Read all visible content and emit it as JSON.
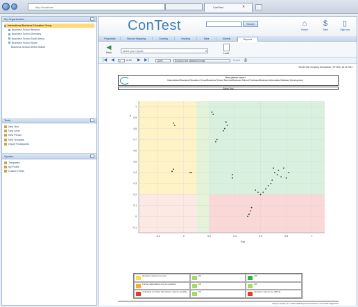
{
  "browser": {
    "address": "http://localhost",
    "tab_title": "ConTest"
  },
  "sidebar": {
    "org_title": "My Organization",
    "tree": [
      "International Business Education Group",
      "Business School Benelux",
      "Business School Germany",
      "Business School South Africa",
      "Business School Spain",
      "Business School United States"
    ],
    "tools_title": "Tests",
    "tools": [
      "New Test",
      "New Level",
      "New Period",
      "New Template",
      "Import Participants"
    ],
    "system_title": "System",
    "system": [
      "Templates",
      "My Profile",
      "Custom Fields"
    ]
  },
  "header": {
    "app_title": "ConTest",
    "search_placeholder": "",
    "search_button": "Search",
    "home_label": "Home",
    "jobs_label": "Jobs",
    "signout_label": "Sign out",
    "home_icon": "house-icon",
    "jobs_icon": "dollar-icon",
    "signout_icon": "door-icon"
  },
  "tabs": [
    "Properties",
    "Second Mapping",
    "Scoring",
    "Grading",
    "Data",
    "Models",
    "Reports"
  ],
  "active_tab": "Reports",
  "toolbar": {
    "back_label": "Back",
    "report_select_value": "select your reports",
    "load_label": "Load"
  },
  "viewer": {
    "page_value": "1",
    "page_of": "of 13",
    "zoom_value": "100%",
    "export_label": "Export to the selected format",
    "export_link": "Export",
    "timestamp": "Telerik Vide Scripting Introduction (TST301) 16.11.2011"
  },
  "report": {
    "title": "New please report",
    "subtitle": "International Business Education Group/Business School Benelux/Business School Professor/Business Information/Software Development",
    "strip": "Entire Test",
    "footer": "Report version: 2.1.1116.1461 Report Generated: 16.11.2011 Page:6/13"
  },
  "chart_data": {
    "type": "scatter",
    "xlabel": "Rar",
    "ylabel": "p",
    "xticks": [
      "-0.2",
      "0",
      "0.2",
      "0.4",
      "0.6",
      "0.8",
      "1"
    ],
    "yticks": [
      "-0.1",
      "0",
      "0.1",
      "0.2",
      "0.3",
      "0.4",
      "0.5",
      "0.6",
      "0.7",
      "0.8",
      "0.9",
      "1"
    ],
    "xlim": [
      -0.35,
      1.1
    ],
    "ylim": [
      -0.15,
      1.05
    ],
    "zones": [
      {
        "x": [
          -0.35,
          0.1
        ],
        "y": [
          0.2,
          1.05
        ],
        "color": "#fdf3c6"
      },
      {
        "x": [
          0.1,
          0.2
        ],
        "y": [
          0.2,
          1.05
        ],
        "color": "#e2f3d8"
      },
      {
        "x": [
          0.2,
          1.1
        ],
        "y": [
          0.2,
          1.05
        ],
        "color": "#d9f0df"
      },
      {
        "x": [
          -0.35,
          0.1
        ],
        "y": [
          -0.15,
          0.2
        ],
        "color": "#fde9e4"
      },
      {
        "x": [
          0.1,
          0.2
        ],
        "y": [
          -0.15,
          0.2
        ],
        "color": "#e6f2da"
      },
      {
        "x": [
          0.2,
          1.1
        ],
        "y": [
          -0.15,
          0.2
        ],
        "color": "#fbd8d8"
      }
    ],
    "points": [
      {
        "x": -0.08,
        "y": 0.85
      },
      {
        "x": -0.07,
        "y": 0.83
      },
      {
        "x": -0.09,
        "y": 0.41
      },
      {
        "x": -0.08,
        "y": 0.43
      },
      {
        "x": 0.05,
        "y": 0.4
      },
      {
        "x": 0.06,
        "y": 0.4
      },
      {
        "x": 0.22,
        "y": 0.95
      },
      {
        "x": 0.23,
        "y": 0.93
      },
      {
        "x": 0.33,
        "y": 0.86
      },
      {
        "x": 0.34,
        "y": 0.83
      },
      {
        "x": 0.32,
        "y": 0.8
      },
      {
        "x": 0.31,
        "y": 0.78
      },
      {
        "x": 0.26,
        "y": 0.7
      },
      {
        "x": 0.25,
        "y": 0.68
      },
      {
        "x": 0.38,
        "y": 0.38
      },
      {
        "x": 0.38,
        "y": 0.35
      },
      {
        "x": 0.7,
        "y": 0.44
      },
      {
        "x": 0.71,
        "y": 0.4
      },
      {
        "x": 0.74,
        "y": 0.42
      },
      {
        "x": 0.73,
        "y": 0.38
      },
      {
        "x": 0.76,
        "y": 0.36
      },
      {
        "x": 0.69,
        "y": 0.33
      },
      {
        "x": 0.68,
        "y": 0.3
      },
      {
        "x": 0.66,
        "y": 0.28
      },
      {
        "x": 0.64,
        "y": 0.25
      },
      {
        "x": 0.62,
        "y": 0.22
      },
      {
        "x": 0.6,
        "y": 0.2
      },
      {
        "x": 0.58,
        "y": 0.22
      },
      {
        "x": 0.56,
        "y": 0.24
      },
      {
        "x": 0.8,
        "y": 0.35
      },
      {
        "x": 0.82,
        "y": 0.4
      },
      {
        "x": 0.78,
        "y": 0.44
      },
      {
        "x": 0.52,
        "y": 0.05
      },
      {
        "x": 0.51,
        "y": 0.02
      },
      {
        "x": 0.5,
        "y": 0.0
      },
      {
        "x": 0.53,
        "y": 0.08
      }
    ]
  },
  "legend": [
    {
      "text": "Question may be too easy",
      "color": "#f5e04a"
    },
    {
      "text": "OK",
      "color": "#a6d86b"
    },
    {
      "text": "OK",
      "color": "#2fb24a"
    },
    {
      "text": "Further alternatives may be possible",
      "color": "#f0b030"
    },
    {
      "text": "OK",
      "color": "#a6d86b"
    },
    {
      "text": "OK",
      "color": "#a6d86b"
    },
    {
      "text": "Ambiguity or further alternatives may be possible",
      "color": "#e33a2a"
    },
    {
      "text": "OK",
      "color": "#a6d86b"
    },
    {
      "text": "Question may be too difficult",
      "color": "#e33a2a"
    }
  ]
}
